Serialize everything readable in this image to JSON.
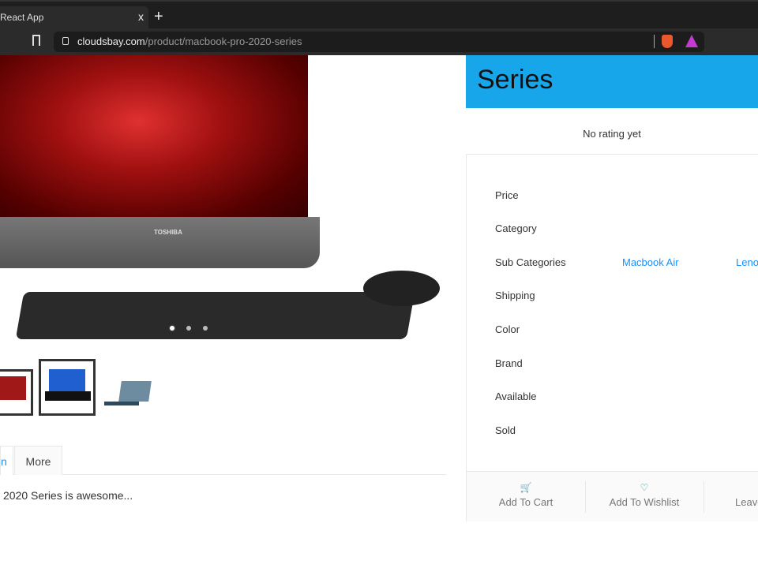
{
  "browser": {
    "tab_title": "React App",
    "close": "x",
    "new_tab": "+",
    "url_domain": "cloudsbay.com",
    "url_path": "/product/macbook-pro-2020-series"
  },
  "gallery": {
    "brand_text": "TOSHIBA",
    "slides": 3,
    "active_slide": 1,
    "selected_thumb": 2
  },
  "tabs": [
    {
      "label": "n"
    },
    {
      "label": "More"
    }
  ],
  "description": "2020 Series is awesome...",
  "product": {
    "title": "Series",
    "rating": "No rating yet",
    "fields": [
      {
        "label": "Price"
      },
      {
        "label": "Category"
      },
      {
        "label": "Sub Categories",
        "values": [
          "Macbook Air",
          "Leno"
        ]
      },
      {
        "label": "Shipping"
      },
      {
        "label": "Color"
      },
      {
        "label": "Brand"
      },
      {
        "label": "Available"
      },
      {
        "label": "Sold"
      }
    ],
    "actions": [
      {
        "label": "Add To Cart",
        "icon": "shopping-cart-icon"
      },
      {
        "label": "Add To Wishlist",
        "icon": "heart-icon"
      },
      {
        "label": "Leave"
      }
    ]
  },
  "colors": {
    "accent": "#1890ff",
    "title_bg": "#17a6ea",
    "cart": "#52c41a",
    "heart": "#13a8a8"
  }
}
